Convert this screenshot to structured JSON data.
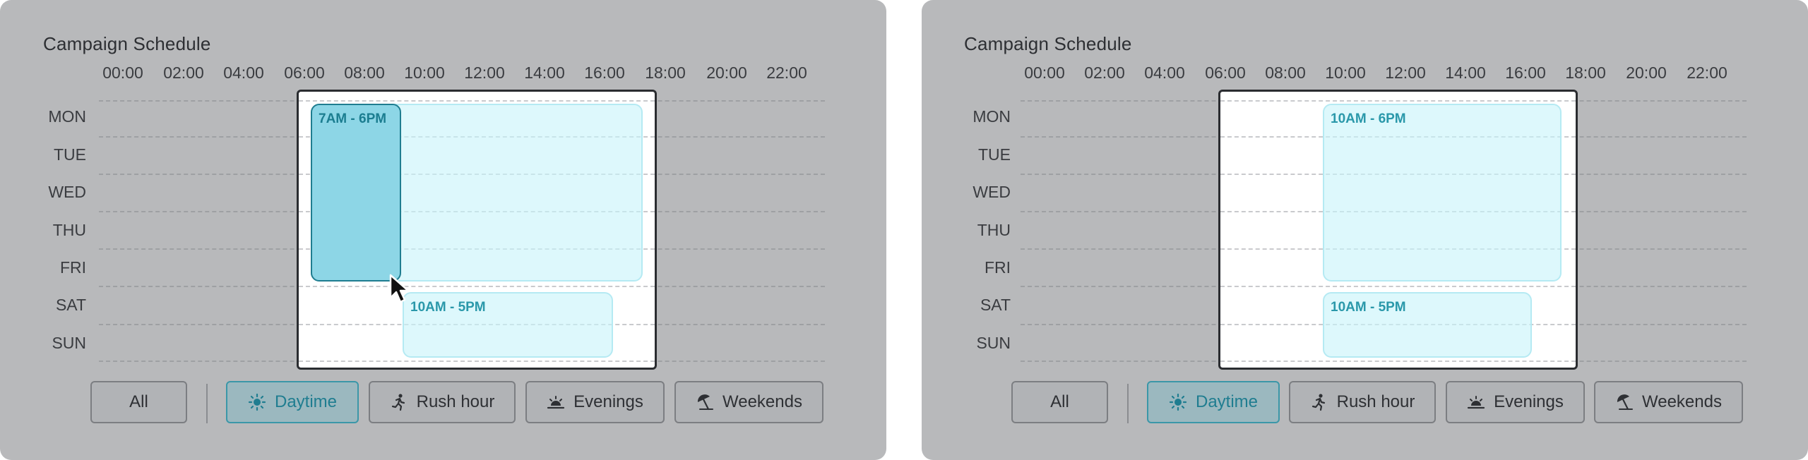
{
  "panels": [
    {
      "title": "Campaign Schedule",
      "hours": [
        "00:00",
        "02:00",
        "04:00",
        "06:00",
        "08:00",
        "10:00",
        "12:00",
        "14:00",
        "16:00",
        "18:00",
        "20:00",
        "22:00"
      ],
      "days": [
        "MON",
        "TUE",
        "WED",
        "THU",
        "FRI",
        "SAT",
        "SUN"
      ],
      "blocks": [
        {
          "label": "7AM - 6PM",
          "state": "active"
        },
        {
          "label": "",
          "state": "preview"
        },
        {
          "label": "10AM - 5PM",
          "state": "normal"
        }
      ],
      "buttons": {
        "all": "All",
        "daytime": "Daytime",
        "rush_hour": "Rush hour",
        "evenings": "Evenings",
        "weekends": "Weekends"
      },
      "active_filter": "Daytime"
    },
    {
      "title": "Campaign Schedule",
      "hours": [
        "00:00",
        "02:00",
        "04:00",
        "06:00",
        "08:00",
        "10:00",
        "12:00",
        "14:00",
        "16:00",
        "18:00",
        "20:00",
        "22:00"
      ],
      "days": [
        "MON",
        "TUE",
        "WED",
        "THU",
        "FRI",
        "SAT",
        "SUN"
      ],
      "blocks": [
        {
          "label": "10AM - 6PM",
          "state": "normal"
        },
        {
          "label": "10AM - 5PM",
          "state": "normal"
        }
      ],
      "buttons": {
        "all": "All",
        "daytime": "Daytime",
        "rush_hour": "Rush hour",
        "evenings": "Evenings",
        "weekends": "Weekends"
      },
      "active_filter": "Daytime"
    }
  ],
  "colors": {
    "panel_bg": "#b8b9bb",
    "block_fill": "#c8f4fa",
    "block_active": "#8dd6e6",
    "accent_text": "#2a98aa",
    "button_active": "#9bb8bf"
  },
  "icons": {
    "daytime": "sun-icon",
    "rush_hour": "running-person-icon",
    "evenings": "sunset-icon",
    "weekends": "beach-umbrella-icon"
  }
}
